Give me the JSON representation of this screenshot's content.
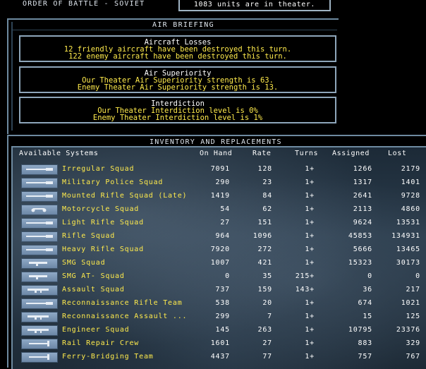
{
  "header": {
    "title": "ORDER OF BATTLE - SOVIET",
    "units_text": "1083 units are in theater."
  },
  "air_briefing": {
    "title": "AIR BRIEFING",
    "losses": {
      "title": "Aircraft Losses",
      "line1": "12 friendly aircraft have been destroyed this turn.",
      "line2": "122 enemy aircraft have been destroyed this turn."
    },
    "superiority": {
      "title": "Air Superiority",
      "line1": "Our Theater Air Superiority strength is 63.",
      "line2": "Enemy Theater Air Superiority strength is 13."
    },
    "interdiction": {
      "title": "Interdiction",
      "line1": "Our Theater Interdiction level is 0%",
      "line2": "Enemy Theater Interdiction level is 1%"
    }
  },
  "inventory": {
    "title": "INVENTORY AND REPLACEMENTS",
    "columns": {
      "systems": "Available Systems",
      "on_hand": "On Hand",
      "rate": "Rate",
      "turns": "Turns",
      "assigned": "Assigned",
      "lost": "Lost"
    },
    "rows": [
      {
        "icon": "rifle-icon",
        "name": "Irregular Squad",
        "on_hand": "7091",
        "rate": "128",
        "turns": "1+",
        "assigned": "1266",
        "lost": "2179"
      },
      {
        "icon": "rifle-icon",
        "name": "Military Police Squad",
        "on_hand": "290",
        "rate": "23",
        "turns": "1+",
        "assigned": "1317",
        "lost": "1401"
      },
      {
        "icon": "rifle-icon",
        "name": "Mounted Rifle Squad (Late)",
        "on_hand": "1419",
        "rate": "84",
        "turns": "1+",
        "assigned": "2641",
        "lost": "9728"
      },
      {
        "icon": "motorcycle-icon",
        "name": "Motorcycle Squad",
        "on_hand": "54",
        "rate": "62",
        "turns": "1+",
        "assigned": "2113",
        "lost": "4860"
      },
      {
        "icon": "rifle-icon",
        "name": "Light Rifle Squad",
        "on_hand": "27",
        "rate": "151",
        "turns": "1+",
        "assigned": "9624",
        "lost": "13531"
      },
      {
        "icon": "rifle-icon",
        "name": "Rifle Squad",
        "on_hand": "964",
        "rate": "1096",
        "turns": "1+",
        "assigned": "45853",
        "lost": "134931"
      },
      {
        "icon": "rifle-icon",
        "name": "Heavy Rifle Squad",
        "on_hand": "7920",
        "rate": "272",
        "turns": "1+",
        "assigned": "5666",
        "lost": "13465"
      },
      {
        "icon": "smg-icon",
        "name": "SMG Squad",
        "on_hand": "1007",
        "rate": "421",
        "turns": "1+",
        "assigned": "15323",
        "lost": "30173"
      },
      {
        "icon": "smg-icon",
        "name": "SMG AT- Squad",
        "on_hand": "0",
        "rate": "35",
        "turns": "215+",
        "assigned": "0",
        "lost": "0"
      },
      {
        "icon": "assault-rifle-icon",
        "name": "Assault Squad",
        "on_hand": "737",
        "rate": "159",
        "turns": "143+",
        "assigned": "36",
        "lost": "217"
      },
      {
        "icon": "rifle-icon",
        "name": "Reconnaissance Rifle Team",
        "on_hand": "538",
        "rate": "20",
        "turns": "1+",
        "assigned": "674",
        "lost": "1021"
      },
      {
        "icon": "assault-rifle-icon",
        "name": "Reconnaissance Assault ...",
        "on_hand": "299",
        "rate": "7",
        "turns": "1+",
        "assigned": "15",
        "lost": "125"
      },
      {
        "icon": "assault-rifle-icon",
        "name": "Engineer Squad",
        "on_hand": "145",
        "rate": "263",
        "turns": "1+",
        "assigned": "10795",
        "lost": "23376"
      },
      {
        "icon": "tool-icon",
        "name": "Rail Repair Crew",
        "on_hand": "1601",
        "rate": "27",
        "turns": "1+",
        "assigned": "883",
        "lost": "329"
      },
      {
        "icon": "tool-icon",
        "name": "Ferry-Bridging Team",
        "on_hand": "4437",
        "rate": "77",
        "turns": "1+",
        "assigned": "757",
        "lost": "767"
      }
    ]
  }
}
